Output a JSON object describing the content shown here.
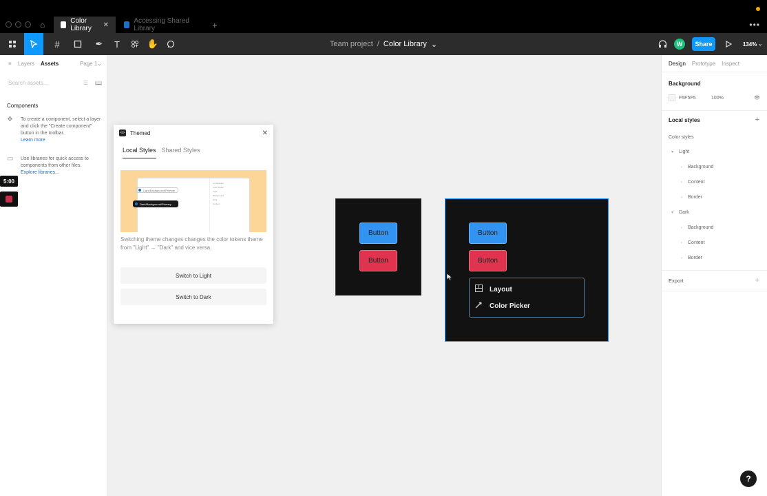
{
  "browser": {
    "tabs": [
      {
        "label": "Color Library"
      },
      {
        "label": "Accessing Shared Library"
      }
    ]
  },
  "header": {
    "project": "Team project",
    "separator": "/",
    "file": "Color Library",
    "avatar_initial": "W",
    "share_label": "Share",
    "zoom": "134%"
  },
  "left_panel": {
    "tab_layers": "Layers",
    "tab_assets": "Assets",
    "page": "Page 1",
    "search_placeholder": "Search assets...",
    "components_title": "Components",
    "components_hint": "To create a component, select a layer and click the \"Create component\" button in the toolbar.",
    "learn_more": "Learn more",
    "libraries_hint": "Use libraries for quick access to components from other files.",
    "explore_libraries": "Explore libraries..."
  },
  "timer": "5:00",
  "plugin": {
    "title": "Themed",
    "tab_local": "Local Styles",
    "tab_shared": "Shared Styles",
    "preview_light": "Light/Background/Primary",
    "preview_dark": "Dark/Background/Primary",
    "description": "Switching theme changes changes the color tokens theme from \"Light\" → \"Dark\" and vice versa.",
    "switch_light": "Switch to Light",
    "switch_dark": "Switch to Dark"
  },
  "canvas": {
    "frame_a": {
      "button_primary": "Button",
      "button_danger": "Button"
    },
    "frame_b": {
      "button_primary": "Button",
      "button_danger": "Button"
    },
    "menu": [
      {
        "label": "Layout",
        "icon": "layout-icon"
      },
      {
        "label": "Color Picker",
        "icon": "eyedropper-icon"
      }
    ]
  },
  "right_panel": {
    "tab_design": "Design",
    "tab_prototype": "Prototype",
    "tab_inspect": "Inspect",
    "background_title": "Background",
    "background_hex": "F5F5F5",
    "background_opacity": "100%",
    "local_styles_title": "Local styles",
    "color_styles_label": "Color styles",
    "groups": [
      {
        "name": "Light",
        "items": [
          "Background",
          "Content",
          "Border"
        ]
      },
      {
        "name": "Dark",
        "items": [
          "Background",
          "Content",
          "Border"
        ]
      }
    ],
    "export_title": "Export"
  },
  "help_label": "?",
  "colors": {
    "accent": "#0d99ff",
    "button_blue": "#3393f0",
    "button_red": "#e0334f",
    "frame_bg": "#121212",
    "preview_bg": "#fcd699"
  }
}
